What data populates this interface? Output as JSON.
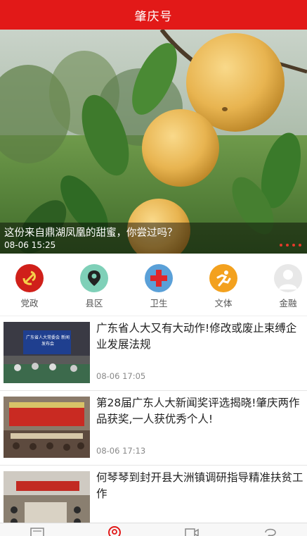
{
  "header": {
    "title": "肇庆号",
    "color": "#e21918"
  },
  "banner": {
    "title": "这份来自鼎湖凤凰的甜蜜，你尝过吗？",
    "time": "08-06  15:25",
    "slide_count": 4,
    "active_slide": 4
  },
  "categories": [
    {
      "label": "党政",
      "icon": "party-emblem-icon"
    },
    {
      "label": "县区",
      "icon": "location-pin-icon"
    },
    {
      "label": "卫生",
      "icon": "red-cross-icon"
    },
    {
      "label": "文体",
      "icon": "runner-icon"
    },
    {
      "label": "金融",
      "icon": "avatar-icon"
    }
  ],
  "news": [
    {
      "title": "广东省人大又有大动作!修改或废止束缚企业发展法规",
      "time": "08-06  17:05",
      "thumb_text": "广东省人大常委会 新闻发布会"
    },
    {
      "title": "第28届广东人大新闻奖评选揭晓!肇庆两作品获奖,一人获优秀个人!",
      "time": "08-06  17:13",
      "thumb_text": ""
    },
    {
      "title": "何琴琴到封开县大洲镇调研指导精准扶贫工作",
      "time": "",
      "thumb_text": ""
    }
  ],
  "bottom_nav": [
    {
      "icon": "news-icon"
    },
    {
      "icon": "location-icon"
    },
    {
      "icon": "video-icon"
    },
    {
      "icon": "chat-icon"
    }
  ]
}
